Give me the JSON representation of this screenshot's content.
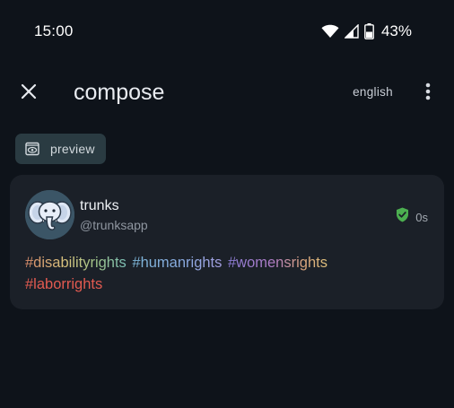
{
  "status_bar": {
    "time": "15:00",
    "battery_percent": "43%",
    "icons": [
      "wifi-icon",
      "signal-icon",
      "battery-icon"
    ]
  },
  "app_bar": {
    "close_icon": "close-icon",
    "title": "compose",
    "language": "english",
    "more_icon": "more-vert-icon"
  },
  "preview_chip": {
    "icon": "eye-icon",
    "label": "preview"
  },
  "post": {
    "display_name": "trunks",
    "handle": "@trunksapp",
    "avatar_icon": "elephant-icon",
    "verified_icon": "shield-check-icon",
    "timestamp": "0s",
    "hashtags": [
      "#disabilityrights",
      "#humanrights",
      "#womensrights",
      "#laborrights"
    ]
  },
  "colors": {
    "background": "#0e131a",
    "card": "#1b2028",
    "chip": "#2a3b42",
    "verified": "#4caf50",
    "labor_tag": "#e25a50"
  }
}
